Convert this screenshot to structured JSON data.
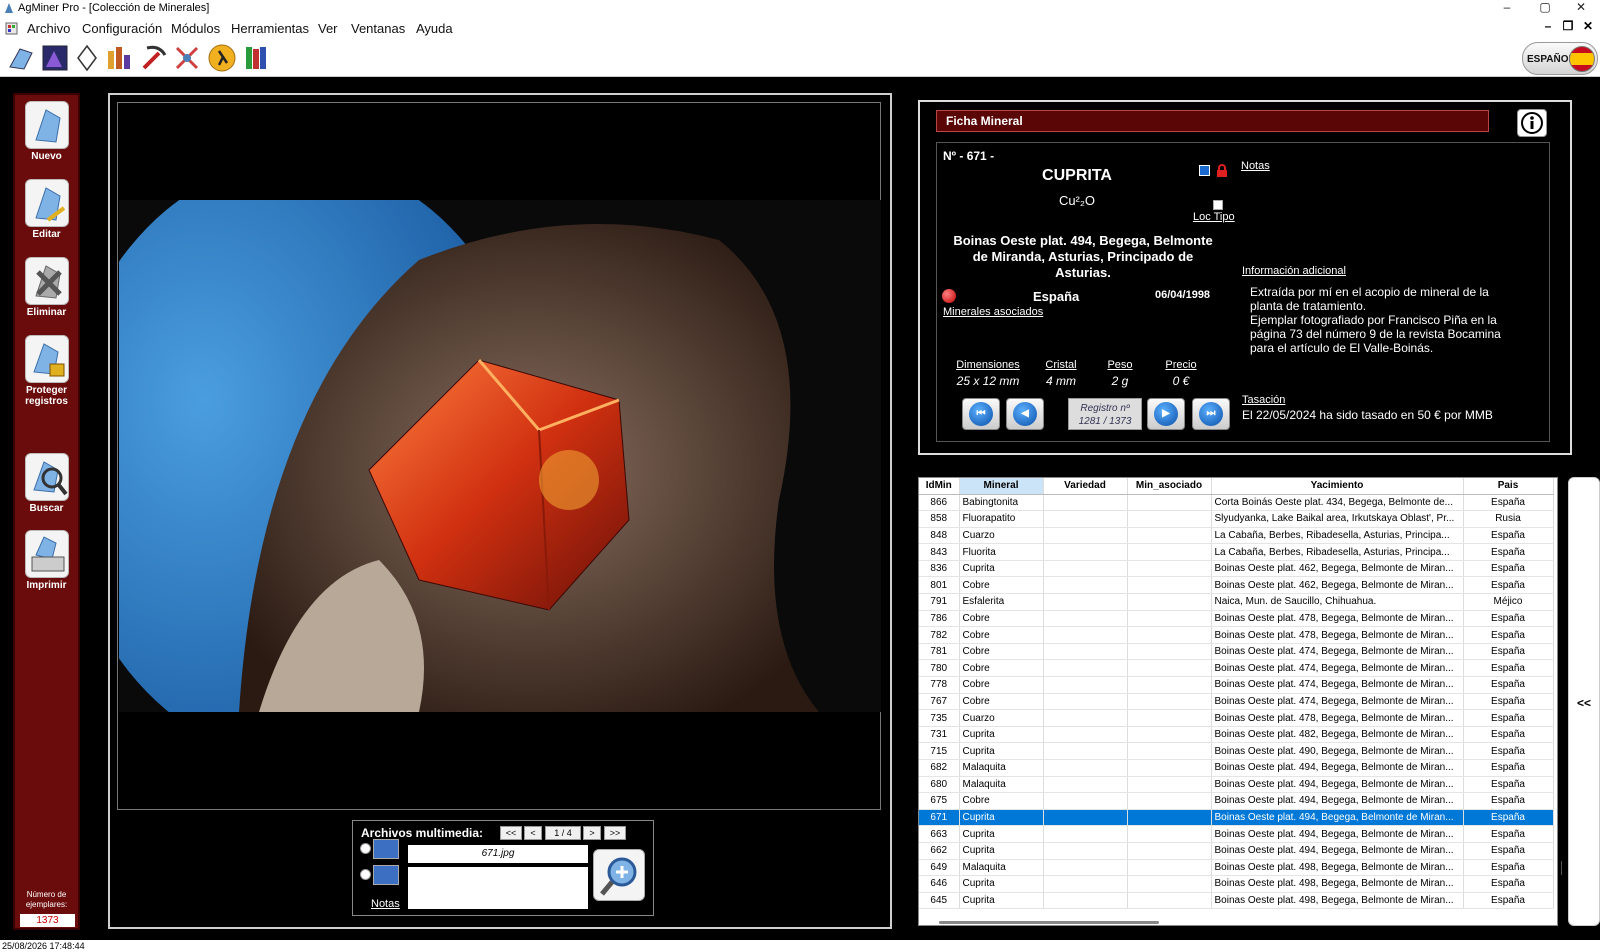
{
  "window": {
    "title": "AgMiner Pro - [Colección de Minerales]",
    "minimize": "–",
    "maximize": "▢",
    "close": "✕"
  },
  "menu": {
    "items": [
      "Archivo",
      "Configuración",
      "Módulos",
      "Herramientas",
      "Ver",
      "Ventanas",
      "Ayuda"
    ]
  },
  "mdi": {
    "minimize": "–",
    "restore": "❐",
    "close": "✕"
  },
  "language": {
    "label": "ESPAÑOL"
  },
  "sidebar": {
    "buttons": [
      "Nuevo",
      "Editar",
      "Eliminar",
      "Proteger registros",
      "Buscar",
      "Imprimir"
    ],
    "count_label": "Número de ejemplares:",
    "count_value": "1373"
  },
  "media": {
    "header": "Archivos multimedia:",
    "first": "<<",
    "prev": "<",
    "page": "1 / 4",
    "next": ">",
    "last": ">>",
    "filename": "671.jpg",
    "notes": "Notas"
  },
  "ficha": {
    "header": "Ficha Mineral",
    "number": "Nº - 671 -",
    "name": "CUPRITA",
    "formula": "Cu²₂O",
    "notes_link": "Notas",
    "loc_tipo": "Loc Tipo",
    "locality": "Boinas Oeste plat. 494, Begega, Belmonte de Miranda, Asturias, Principado de Asturias.",
    "country": "España",
    "date": "06/04/1998",
    "associated_link": "Minerales asociados",
    "info_link": "Información adicional",
    "info_text": "Extraída por mí en el acopio de mineral de la planta de tratamiento.\nEjemplar fotografiado por Francisco Piña en la página 73 del número 9 de la revista Bocamina para el artículo de El Valle-Boinás.",
    "attrs": {
      "dim_label": "Dimensiones",
      "dim_value": "25 x 12 mm",
      "cristal_label": "Cristal",
      "cristal_value": "4 mm",
      "peso_label": "Peso",
      "peso_value": "2 g",
      "precio_label": "Precio",
      "precio_value": "0 €"
    },
    "record_label": "Registro nº",
    "record_value": "1281 / 1373",
    "tasacion_link": "Tasación",
    "tasacion_text": "El 22/05/2024 ha sido tasado en 50 € por MMB"
  },
  "table": {
    "columns": [
      "IdMin",
      "Mineral",
      "Variedad",
      "Min_asociado",
      "Yacimiento",
      "Pais"
    ],
    "rows": [
      [
        "866",
        "Babingtonita",
        "",
        "",
        "Corta Boinás Oeste plat. 434, Begega, Belmonte de...",
        "España"
      ],
      [
        "858",
        "Fluorapatito",
        "",
        "",
        "Slyudyanka, Lake Baikal area, Irkutskaya Oblast', Pr...",
        "Rusia"
      ],
      [
        "848",
        "Cuarzo",
        "",
        "",
        "La Cabaña, Berbes, Ribadesella, Asturias, Principa...",
        "España"
      ],
      [
        "843",
        "Fluorita",
        "",
        "",
        "La Cabaña, Berbes, Ribadesella, Asturias, Principa...",
        "España"
      ],
      [
        "836",
        "Cuprita",
        "",
        "",
        "Boinas Oeste plat. 462, Begega, Belmonte de Miran...",
        "España"
      ],
      [
        "801",
        "Cobre",
        "",
        "",
        "Boinas Oeste plat. 462, Begega, Belmonte de Miran...",
        "España"
      ],
      [
        "791",
        "Esfalerita",
        "",
        "",
        "Naica, Mun. de Saucillo, Chihuahua.",
        "Méjico"
      ],
      [
        "786",
        "Cobre",
        "",
        "",
        "Boinas Oeste plat. 478, Begega, Belmonte de Miran...",
        "España"
      ],
      [
        "782",
        "Cobre",
        "",
        "",
        "Boinas Oeste plat. 478, Begega, Belmonte de Miran...",
        "España"
      ],
      [
        "781",
        "Cobre",
        "",
        "",
        "Boinas Oeste plat. 474, Begega, Belmonte de Miran...",
        "España"
      ],
      [
        "780",
        "Cobre",
        "",
        "",
        "Boinas Oeste plat. 474, Begega, Belmonte de Miran...",
        "España"
      ],
      [
        "778",
        "Cobre",
        "",
        "",
        "Boinas Oeste plat. 474, Begega, Belmonte de Miran...",
        "España"
      ],
      [
        "767",
        "Cobre",
        "",
        "",
        "Boinas Oeste plat. 474, Begega, Belmonte de Miran...",
        "España"
      ],
      [
        "735",
        "Cuarzo",
        "",
        "",
        "Boinas Oeste plat. 478, Begega, Belmonte de Miran...",
        "España"
      ],
      [
        "731",
        "Cuprita",
        "",
        "",
        "Boinas Oeste plat. 482, Begega, Belmonte de Miran...",
        "España"
      ],
      [
        "715",
        "Cuprita",
        "",
        "",
        "Boinas Oeste plat. 490, Begega, Belmonte de Miran...",
        "España"
      ],
      [
        "682",
        "Malaquita",
        "",
        "",
        "Boinas Oeste plat. 494, Begega, Belmonte de Miran...",
        "España"
      ],
      [
        "680",
        "Malaquita",
        "",
        "",
        "Boinas Oeste plat. 494, Begega, Belmonte de Miran...",
        "España"
      ],
      [
        "675",
        "Cobre",
        "",
        "",
        "Boinas Oeste plat. 494, Begega, Belmonte de Miran...",
        "España"
      ],
      [
        "671",
        "Cuprita",
        "",
        "",
        "Boinas Oeste plat. 494, Begega, Belmonte de Miran...",
        "España"
      ],
      [
        "663",
        "Cuprita",
        "",
        "",
        "Boinas Oeste plat. 494, Begega, Belmonte de Miran...",
        "España"
      ],
      [
        "662",
        "Cuprita",
        "",
        "",
        "Boinas Oeste plat. 494, Begega, Belmonte de Miran...",
        "España"
      ],
      [
        "649",
        "Malaquita",
        "",
        "",
        "Boinas Oeste plat. 498, Begega, Belmonte de Miran...",
        "España"
      ],
      [
        "646",
        "Cuprita",
        "",
        "",
        "Boinas Oeste plat. 498, Begega, Belmonte de Miran...",
        "España"
      ],
      [
        "645",
        "Cuprita",
        "",
        "",
        "Boinas Oeste plat. 498, Begega, Belmonte de Miran...",
        "España"
      ]
    ],
    "selected_row": 19,
    "side_toggle": "<<"
  },
  "status": {
    "datetime": "25/08/2026 17:48:44"
  },
  "colors": {
    "sidebar": "#6b0c0c",
    "selection": "#0078d7",
    "header": "#5a0606"
  }
}
